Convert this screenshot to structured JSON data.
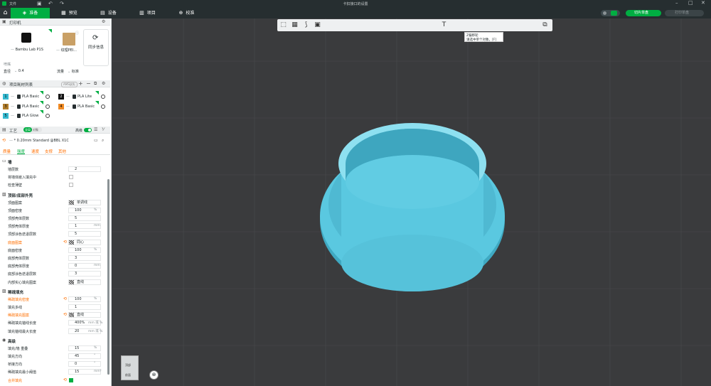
{
  "app": {
    "title": "卡扣接口的设置",
    "menu": "文件"
  },
  "tabs": [
    {
      "label": "准备",
      "icon": "prepare-icon"
    },
    {
      "label": "预览",
      "icon": "preview-icon"
    },
    {
      "label": "设备",
      "icon": "device-icon"
    },
    {
      "label": "项目",
      "icon": "project-icon"
    },
    {
      "label": "校准",
      "icon": "calibration-icon"
    }
  ],
  "actions": {
    "slice": "切片单盘",
    "print": "打印单盘"
  },
  "printer": {
    "section": "打印机",
    "name": "Bambu Lab P1S",
    "plate": "纹理PEI...",
    "sync": "同步信息",
    "nozzle_label": "喷嘴",
    "diameter_label": "直径",
    "diameter": "0.4",
    "flow_label": "流量",
    "flow": "标准"
  },
  "filament": {
    "section": "项目耗材列表",
    "tag": "AMS缺失",
    "items": [
      {
        "num": "1",
        "name": "PLA Basic",
        "color": "#34b9d0"
      },
      {
        "num": "2",
        "name": "PLA Lite",
        "color": "#111111"
      },
      {
        "num": "3",
        "name": "PLA Basic",
        "color": "#b07d2b"
      },
      {
        "num": "4",
        "name": "PLA Basic",
        "color": "#f08a24"
      },
      {
        "num": "5",
        "name": "PLA Glow",
        "color": "#34b9d0"
      }
    ]
  },
  "process": {
    "section": "工艺",
    "global": "全局",
    "object": "对象",
    "advanced": "高级",
    "preset": "* 0.20mm Standard @BBL X1C",
    "tabs": [
      "质量",
      "强度",
      "速度",
      "支撑",
      "其他"
    ],
    "groups": [
      {
        "title": "墙",
        "rows": [
          {
            "label": "墙层数",
            "value": "2",
            "type": "num"
          },
          {
            "label": "将墙体嵌入填充中",
            "type": "check",
            "on": false
          },
          {
            "label": "检查薄壁",
            "type": "check",
            "on": false
          }
        ]
      },
      {
        "title": "顶部/底部外壳",
        "rows": [
          {
            "label": "顶面图案",
            "value": "单调线",
            "type": "pattern"
          },
          {
            "label": "顶面密度",
            "value": "100",
            "unit": "%",
            "type": "num"
          },
          {
            "label": "顶部壳体层数",
            "value": "5",
            "type": "num"
          },
          {
            "label": "顶部壳体厚度",
            "value": "1",
            "unit": "mm",
            "type": "num"
          },
          {
            "label": "顶部涂色迭退层数",
            "value": "5",
            "type": "num"
          },
          {
            "label": "底面图案",
            "value": "同心",
            "type": "pattern",
            "mod": true
          },
          {
            "label": "底面密度",
            "value": "100",
            "unit": "%",
            "type": "num"
          },
          {
            "label": "底部壳体层数",
            "value": "3",
            "type": "num"
          },
          {
            "label": "底部壳体厚度",
            "value": "0",
            "unit": "mm",
            "type": "num"
          },
          {
            "label": "底部涂色迭退层数",
            "value": "3",
            "type": "num"
          },
          {
            "label": "内部实心填充图案",
            "value": "直线",
            "type": "pattern"
          }
        ]
      },
      {
        "title": "稀疏填充",
        "rows": [
          {
            "label": "稀疏填充密度",
            "value": "100",
            "unit": "%",
            "type": "num",
            "mod": true
          },
          {
            "label": "填充多线",
            "value": "1",
            "type": "num"
          },
          {
            "label": "稀疏填充图案",
            "value": "直线",
            "type": "pattern",
            "mod": true
          },
          {
            "label": "稀疏填充锚线长度",
            "value": "400%",
            "unit": "mm 或 %",
            "type": "num"
          },
          {
            "label": "填充锚线最大长度",
            "value": "20",
            "unit": "mm 或 %",
            "type": "num"
          }
        ]
      },
      {
        "title": "高级",
        "rows": [
          {
            "label": "填充/墙 重叠",
            "value": "15",
            "unit": "%",
            "type": "num"
          },
          {
            "label": "填充方向",
            "value": "45",
            "unit": "°",
            "type": "num"
          },
          {
            "label": "桥接方向",
            "value": "0",
            "unit": "°",
            "type": "num"
          },
          {
            "label": "稀疏填充最小阈值",
            "value": "15",
            "unit": "mm²",
            "type": "num"
          },
          {
            "label": "合并填充",
            "type": "check",
            "on": true,
            "mod": true
          }
        ]
      }
    ]
  },
  "viewport": {
    "tooltip_title": "Z偏移轮",
    "tooltip_body": "请选中单个对象。[F]",
    "cube_top": "顶部",
    "cube_front": "前面"
  },
  "colors": {
    "accent": "#00ae42",
    "model": "#5ac8e0",
    "bg": "#3a3b3d"
  }
}
